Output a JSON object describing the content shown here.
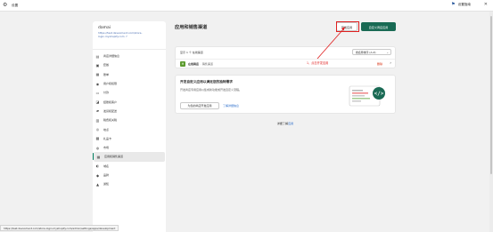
{
  "topbar": {
    "title": "设置",
    "guide_label": "设置指南"
  },
  "sidebar": {
    "store_name": "damai",
    "store_url": "https://test.devsoment.com/store-login.myshopify.com ↗",
    "items": [
      {
        "label": "商店详细信息",
        "icon": "store-icon"
      },
      {
        "label": "套餐",
        "icon": "plan-icon"
      },
      {
        "label": "账单",
        "icon": "billing-icon"
      },
      {
        "label": "用户和权限",
        "icon": "user-icon"
      },
      {
        "label": "付款",
        "icon": "payment-icon"
      },
      {
        "label": "结账和客户",
        "icon": "checkout-icon"
      },
      {
        "label": "发货和配送",
        "icon": "shipping-icon"
      },
      {
        "label": "税费和关税",
        "icon": "tax-icon"
      },
      {
        "label": "地点",
        "icon": "location-icon"
      },
      {
        "label": "礼品卡",
        "icon": "gift-icon"
      },
      {
        "label": "市场",
        "icon": "market-icon"
      },
      {
        "label": "应用和销售渠道",
        "icon": "apps-icon"
      },
      {
        "label": "域名",
        "icon": "domain-icon"
      },
      {
        "label": "品牌",
        "icon": "brand-icon"
      },
      {
        "label": "通知",
        "icon": "bell-icon"
      }
    ]
  },
  "main": {
    "title": "应用和销售渠道",
    "dev_button": "开发应用",
    "create_button": "自定义商店应用",
    "count_text": "显示 1 个 在线渠道",
    "sort_label": "按名称排序 (A-Z)",
    "app_name": "在线商店",
    "app_sub": "· 销售渠道",
    "delete_label": "删除",
    "card2_title": "开发自定义应用以满足您的独特需求",
    "card2_desc": "开发商店专用应用以集成新功能或开发自定义流程。",
    "card2_btn": "为您的商店开发应用",
    "card2_link": "了解详细信息",
    "footer_prefix": "详细了解",
    "footer_link": "应用"
  },
  "annotation": {
    "text": "1、点击开发应用",
    "color": "#e02020"
  },
  "statusbar": {
    "text": "https://test.devsoment.com/store-login.myshopify.com/admin/settings/apps/development"
  },
  "colors": {
    "accent": "#196a54",
    "link": "#2c6ecb",
    "danger": "#d72c0d"
  }
}
